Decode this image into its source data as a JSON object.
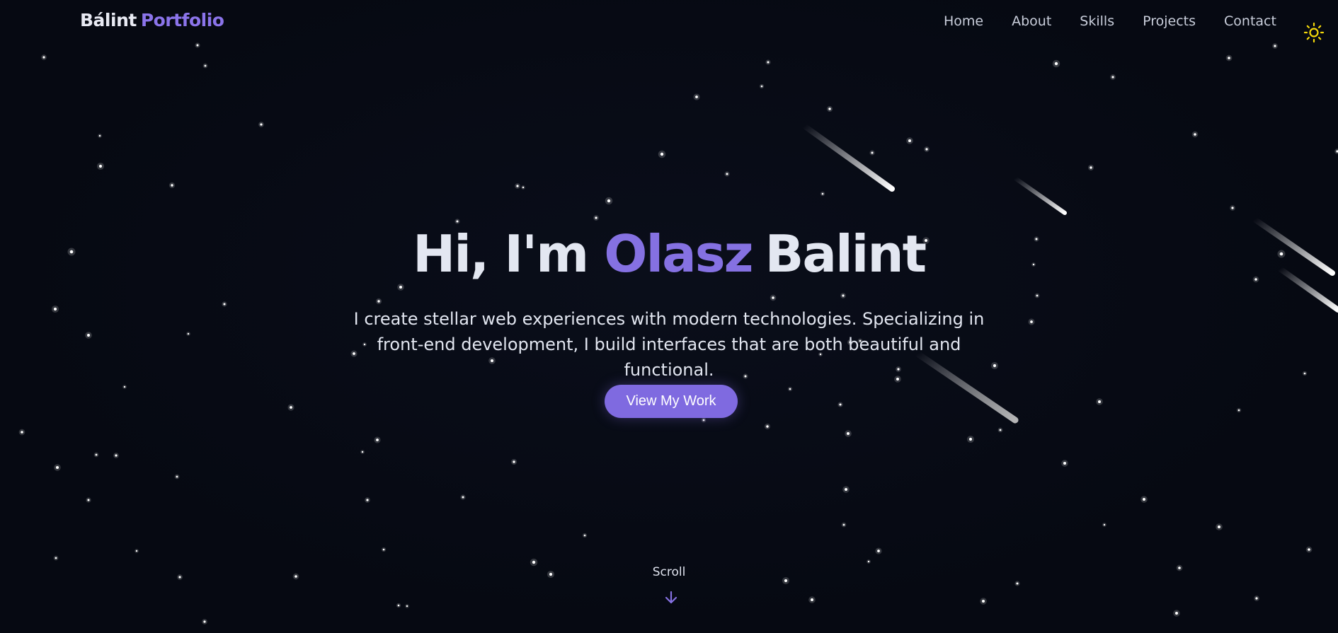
{
  "header": {
    "logo_first": "Bálint",
    "logo_second": "Portfolio",
    "nav": [
      {
        "label": "Home"
      },
      {
        "label": "About"
      },
      {
        "label": "Skills"
      },
      {
        "label": "Projects"
      },
      {
        "label": "Contact"
      }
    ],
    "theme_icon": "sun-icon"
  },
  "hero": {
    "title_prefix": "Hi, I'm",
    "title_first": "Olasz",
    "title_last": "Balint",
    "description": "I create stellar web experiences with modern technologies. Specializing in front-end development, I build interfaces that are both beautiful and functional.",
    "cta_label": "View My Work"
  },
  "scroll": {
    "label": "Scroll",
    "icon": "arrow-down-icon"
  },
  "colors": {
    "background": "#060912",
    "accent": "#8571e2",
    "button": "#7f6ae0",
    "sun": "#f5d90a"
  }
}
